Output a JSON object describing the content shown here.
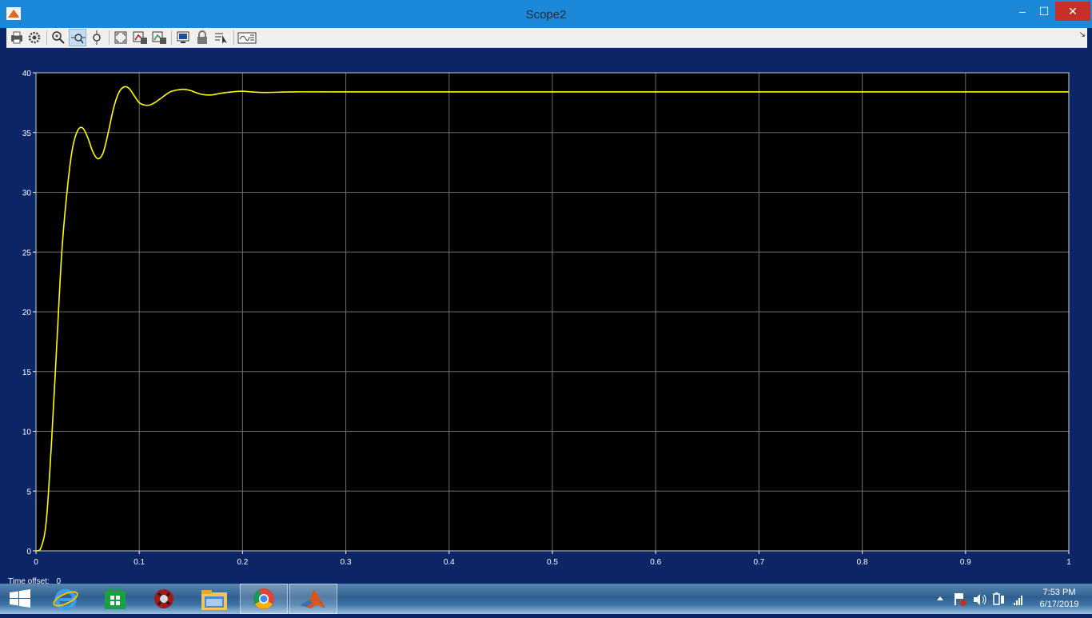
{
  "window": {
    "title": "Scope2",
    "minimize_label": "–",
    "maximize_label": "☐",
    "close_label": "✕"
  },
  "toolbar": {
    "buttons": [
      {
        "icon": "print-icon"
      },
      {
        "icon": "parameters-icon"
      },
      {
        "icon": "zoom-in-icon"
      },
      {
        "icon": "zoom-x-icon",
        "active": true
      },
      {
        "icon": "zoom-y-icon"
      },
      {
        "icon": "autoscale-icon"
      },
      {
        "icon": "save-axes-settings-icon"
      },
      {
        "icon": "restore-axes-settings-icon"
      },
      {
        "icon": "floating-scope-icon"
      },
      {
        "icon": "lock-axes-icon"
      },
      {
        "icon": "signal-selection-icon"
      },
      {
        "icon": "legend-icon"
      }
    ],
    "menu_arrow": "↘"
  },
  "status": {
    "label": "Time offset:",
    "value": "0"
  },
  "taskbar": {
    "apps": [
      "windows-start-icon",
      "internet-explorer-icon",
      "store-icon",
      "app-icon",
      "file-explorer-icon",
      "chrome-icon",
      "matlab-icon"
    ],
    "tray_icons": [
      "show-hidden-icons-icon",
      "action-center-flag-icon",
      "volume-icon",
      "power-icon",
      "network-signal-icon"
    ],
    "time": "7:53 PM",
    "date": "6/17/2019"
  },
  "colors": {
    "plot_bg": "#000000",
    "frame": "#0b2566",
    "trace": "#ffff00",
    "grid": "#6e6e6e",
    "tick_text": "#ffffff"
  },
  "chart_data": {
    "type": "line",
    "xlim": [
      0,
      1
    ],
    "ylim": [
      0,
      40
    ],
    "x_ticks": [
      "0",
      "0.1",
      "0.2",
      "0.3",
      "0.4",
      "0.5",
      "0.6",
      "0.7",
      "0.8",
      "0.9",
      "1"
    ],
    "y_ticks": [
      "0",
      "5",
      "10",
      "15",
      "20",
      "25",
      "30",
      "35",
      "40"
    ],
    "grid": true,
    "series": [
      {
        "x": [
          0,
          0.005,
          0.01,
          0.015,
          0.02,
          0.025,
          0.03,
          0.035,
          0.04,
          0.045,
          0.05,
          0.055,
          0.06,
          0.065,
          0.07,
          0.075,
          0.08,
          0.085,
          0.09,
          0.095,
          0.1,
          0.105,
          0.11,
          0.115,
          0.12,
          0.13,
          0.14,
          0.145,
          0.15,
          0.16,
          0.17,
          0.18,
          0.19,
          0.2,
          0.22,
          0.25,
          0.3,
          0.4,
          0.6,
          0.8,
          1.0
        ],
        "y": [
          0,
          0.3,
          2.5,
          9,
          17,
          25,
          30,
          33.5,
          35.1,
          35.4,
          34.6,
          33.4,
          32.8,
          33.3,
          35,
          37,
          38.3,
          38.8,
          38.7,
          38.1,
          37.5,
          37.3,
          37.3,
          37.5,
          37.8,
          38.4,
          38.6,
          38.6,
          38.5,
          38.2,
          38.15,
          38.3,
          38.4,
          38.45,
          38.35,
          38.4,
          38.4,
          38.4,
          38.4,
          38.4,
          38.4
        ]
      }
    ]
  }
}
